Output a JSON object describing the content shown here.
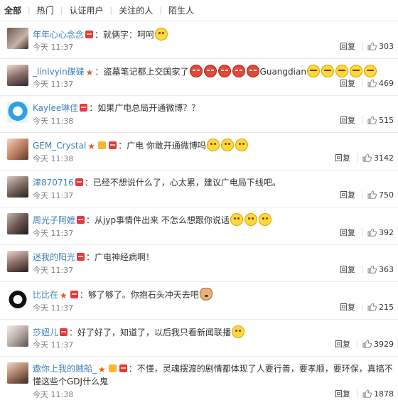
{
  "tabs": [
    "全部",
    "热门",
    "认证用户",
    "关注的人",
    "陌生人"
  ],
  "reply_label": "回复",
  "comments": [
    {
      "user": "年年心心念念",
      "text": "：就俩字：呵呵",
      "time": "今天 11:37",
      "likes": "303"
    },
    {
      "user": "_linlvyin碟碟",
      "text": "：盗墓笔记都上交国家了",
      "text2": "Guangdian",
      "time": "今天 11:37",
      "likes": "469"
    },
    {
      "user": "Kaylee琳佳",
      "text": "：如果广电总局开通微博？？",
      "time": "今天 11:38",
      "likes": "515"
    },
    {
      "user": "GEM_Crystal",
      "text": "：广电 你敢开通微博吗",
      "time": "今天 11:38",
      "likes": "3142"
    },
    {
      "user": "津870716",
      "text": "：已经不想说什么了，心太累，建议广电局下线吧。",
      "time": "今天 11:37",
      "likes": "750"
    },
    {
      "user": "周光子阿嬷",
      "text": "：从jyp事情件出来 不怎么想跟你说话",
      "time": "今天 11:37",
      "likes": "392"
    },
    {
      "user": "迷我的阳光",
      "text": "：广电神经病啊！",
      "time": "今天 11:37",
      "likes": "363"
    },
    {
      "user": "比比在",
      "text": "：够了够了。你抱石头冲天去吧",
      "time": "今天 11:37",
      "likes": "215"
    },
    {
      "user": "莎妞儿",
      "text": "：好了好了，知道了，以后我只看新闻联播",
      "time": "今天 11:37",
      "likes": "3929"
    },
    {
      "user": "遨你上我的贼船_",
      "text": "：不懂，灵魂摆渡的剧情都体现了人要行善，要孝顺，要环保，真搞不懂这些个GDJ什么鬼",
      "time": "今天 11:38",
      "likes": "1878"
    }
  ]
}
